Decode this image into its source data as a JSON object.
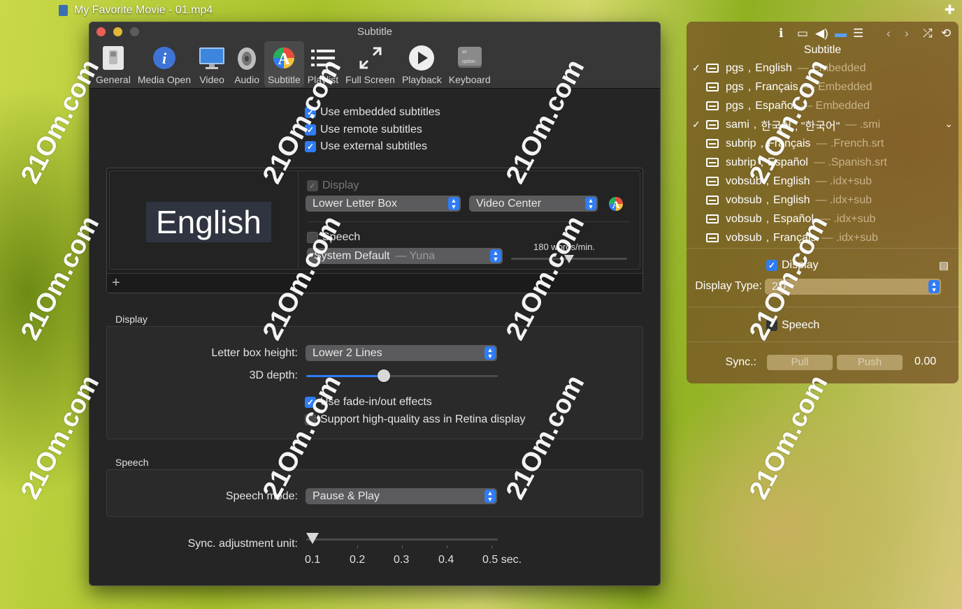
{
  "movie_window": {
    "title": "My Favorite Movie - 01.mp4"
  },
  "prefs": {
    "title": "Subtitle",
    "toolbar": [
      {
        "label": "General",
        "icon": "switch-icon"
      },
      {
        "label": "Media Open",
        "icon": "info-icon"
      },
      {
        "label": "Video",
        "icon": "monitor-icon"
      },
      {
        "label": "Audio",
        "icon": "speaker-icon"
      },
      {
        "label": "Subtitle",
        "icon": "subtitle-palette-icon",
        "selected": true
      },
      {
        "label": "Playlist",
        "icon": "list-icon"
      },
      {
        "label": "Full Screen",
        "icon": "expand-icon"
      },
      {
        "label": "Playback",
        "icon": "play-icon"
      },
      {
        "label": "Keyboard",
        "icon": "option-key-icon"
      }
    ],
    "checks": {
      "embedded": "Use embedded subtitles",
      "remote": "Use remote subtitles",
      "external": "Use external subtitles"
    },
    "style": {
      "preview_text": "English",
      "display_label": "Display",
      "position_value": "Lower Letter Box",
      "alignment_value": "Video Center",
      "speech_label": "Speech",
      "voice_value": "System Default",
      "voice_sub": "— Yuna",
      "rate_label": "180 words/min."
    },
    "display_section": {
      "title": "Display",
      "letterbox_label": "Letter box height:",
      "letterbox_value": "Lower 2 Lines",
      "depth_label": "3D depth:",
      "fade_label": "Use fade-in/out effects",
      "retina_label": "Support high-quality ass in Retina display"
    },
    "speech_section": {
      "title": "Speech",
      "mode_label": "Speech mode:",
      "mode_value": "Pause & Play"
    },
    "sync": {
      "label": "Sync. adjustment unit:",
      "ticks": [
        "0.1",
        "0.2",
        "0.3",
        "0.4",
        "0.5 sec."
      ]
    }
  },
  "hud": {
    "title": "Subtitle",
    "tracks": [
      {
        "checked": true,
        "type": "pgs",
        "lang": "English",
        "src": "— Embedded"
      },
      {
        "checked": false,
        "type": "pgs",
        "lang": "Français",
        "src": "— Embedded"
      },
      {
        "checked": false,
        "type": "pgs",
        "lang": "Español",
        "src": "— Embedded"
      },
      {
        "checked": true,
        "type": "sami",
        "lang": "한국어 , \"한국어\"",
        "src": "— .smi"
      },
      {
        "checked": false,
        "type": "subrip",
        "lang": "Français",
        "src": "— .French.srt"
      },
      {
        "checked": false,
        "type": "subrip",
        "lang": "Español",
        "src": "— .Spanish.srt"
      },
      {
        "checked": false,
        "type": "vobsub",
        "lang": "English",
        "src": "— .idx+sub"
      },
      {
        "checked": false,
        "type": "vobsub",
        "lang": "English",
        "src": "— .idx+sub"
      },
      {
        "checked": false,
        "type": "vobsub",
        "lang": "Español",
        "src": "— .idx+sub"
      },
      {
        "checked": false,
        "type": "vobsub",
        "lang": "Français",
        "src": "— .idx+sub"
      }
    ],
    "display_label": "Display",
    "display_type_label": "Display Type:",
    "display_type_value": "2D",
    "speech_label": "Speech",
    "sync_label": "Sync.:",
    "pull_label": "Pull",
    "push_label": "Push",
    "sync_value": "0.00"
  },
  "watermark": "21Om.com",
  "colors": {
    "accent": "#2f7cf6",
    "window_bg": "#252526",
    "hud_bg": "#7a5826"
  }
}
